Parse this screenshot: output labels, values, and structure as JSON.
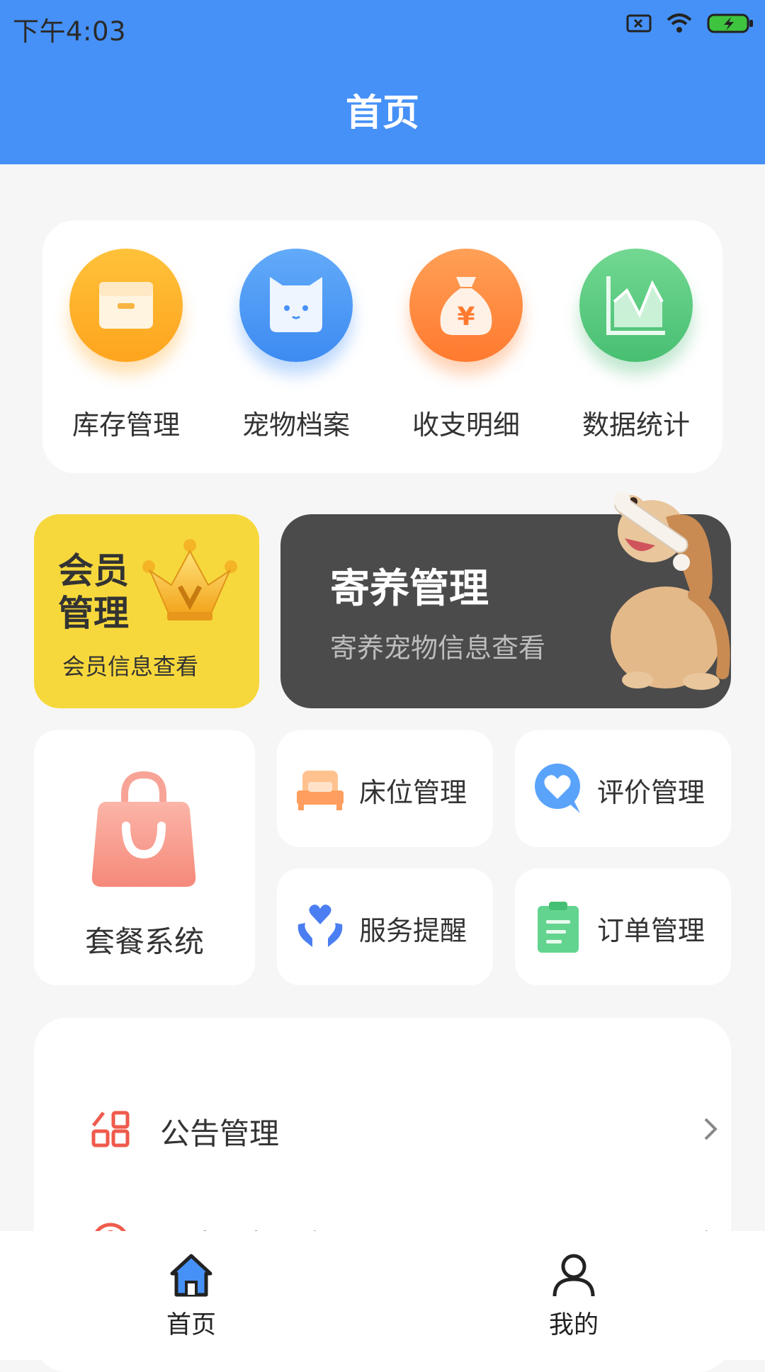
{
  "status": {
    "time": "下午4:03"
  },
  "header": {
    "title": "首页"
  },
  "quick": {
    "items": [
      {
        "label": "库存管理",
        "icon": "box-icon"
      },
      {
        "label": "宠物档案",
        "icon": "cat-face-icon"
      },
      {
        "label": "收支明细",
        "icon": "money-bag-icon"
      },
      {
        "label": "数据统计",
        "icon": "chart-icon"
      }
    ]
  },
  "member": {
    "title_line1": "会员",
    "title_line2": "管理",
    "subtitle": "会员信息查看"
  },
  "boarding": {
    "title": "寄养管理",
    "subtitle": "寄养宠物信息查看"
  },
  "package": {
    "label": "套餐系统"
  },
  "tiles": {
    "bed": "床位管理",
    "review": "评价管理",
    "service": "服务提醒",
    "order": "订单管理"
  },
  "list": {
    "items": [
      {
        "label": "公告管理"
      },
      {
        "label": "异常上报及提醒"
      }
    ]
  },
  "tabbar": {
    "home": "首页",
    "mine": "我的"
  },
  "colors": {
    "primary": "#4691f7",
    "member_bg": "#f7d83c",
    "boarding_bg": "#4b4b4b"
  }
}
